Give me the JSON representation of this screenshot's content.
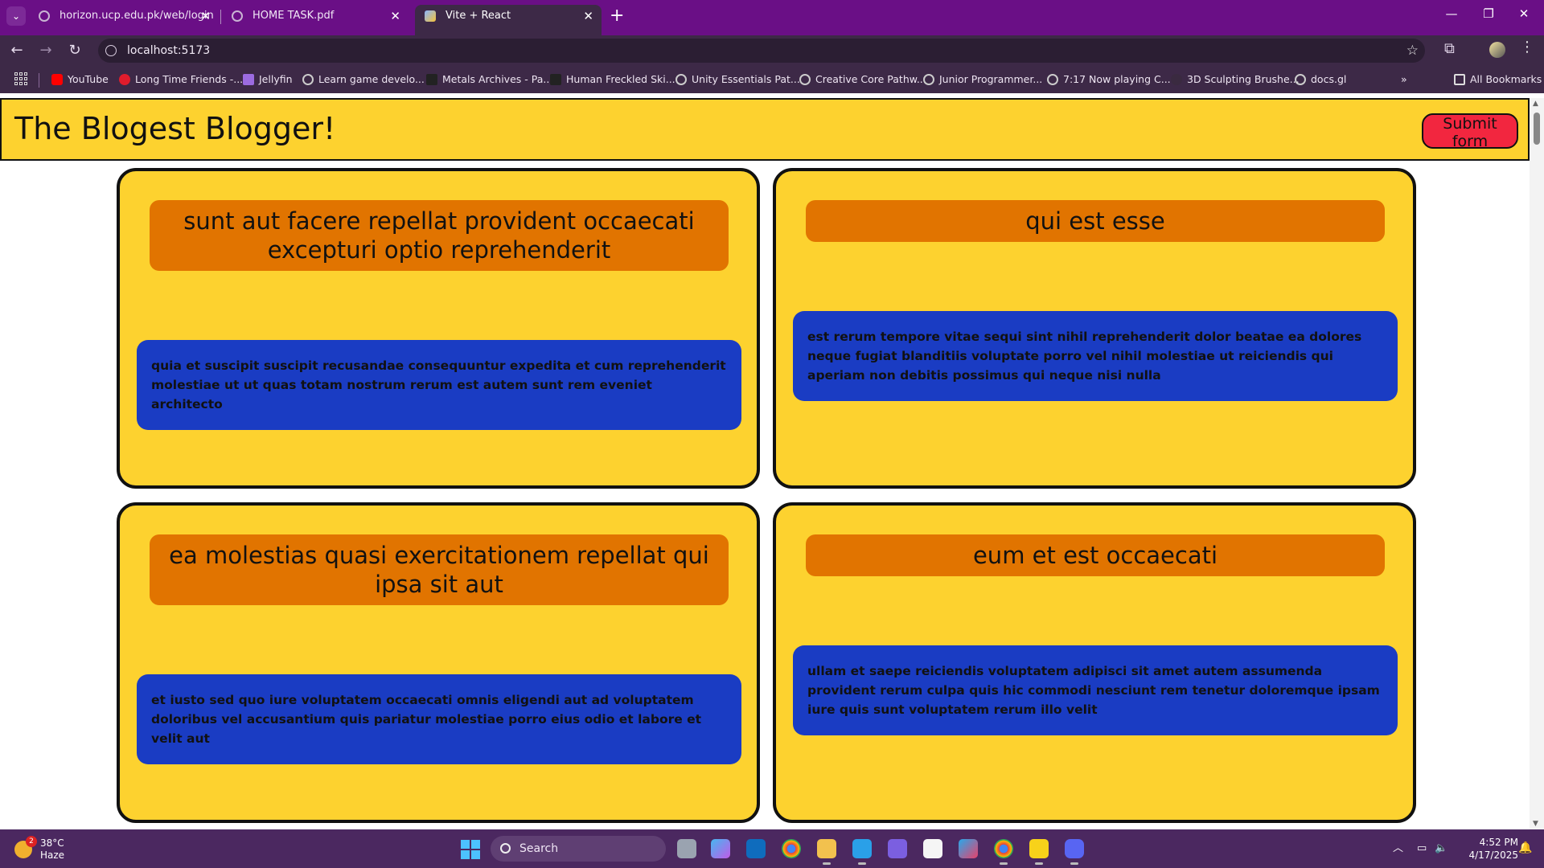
{
  "browser": {
    "tabs": [
      {
        "title": "horizon.ucp.edu.pk/web/login",
        "active": false
      },
      {
        "title": "HOME TASK.pdf",
        "active": false
      },
      {
        "title": "Vite + React",
        "active": true
      }
    ],
    "url": "localhost:5173",
    "bookmarks": [
      "YouTube",
      "Long Time Friends -...",
      "Jellyfin",
      "Learn game develo...",
      "Metals Archives - Pa...",
      "Human Freckled Ski...",
      "Unity Essentials Pat...",
      "Creative Core Pathw...",
      "Junior Programmer...",
      "7:17 Now playing C...",
      "3D Sculpting Brushe...",
      "docs.gl"
    ],
    "all_bookmarks": "All Bookmarks",
    "overflow": "»"
  },
  "app": {
    "title": "The Blogest Blogger!",
    "submit_label": "Submit form",
    "colors": {
      "header": "#fdd22f",
      "title_box": "#e17400",
      "body_box": "#1a3cc3",
      "submit": "#f2263f"
    },
    "posts": [
      {
        "title": "sunt aut facere repellat provident occaecati excepturi optio reprehenderit",
        "body": "quia et suscipit suscipit recusandae consequuntur expedita et cum reprehenderit molestiae ut ut quas totam nostrum rerum est autem sunt rem eveniet architecto"
      },
      {
        "title": "qui est esse",
        "body": "est rerum tempore vitae sequi sint nihil reprehenderit dolor beatae ea dolores neque fugiat blanditiis voluptate porro vel nihil molestiae ut reiciendis qui aperiam non debitis possimus qui neque nisi nulla"
      },
      {
        "title": "ea molestias quasi exercitationem repellat qui ipsa sit aut",
        "body": "et iusto sed quo iure voluptatem occaecati omnis eligendi aut ad voluptatem doloribus vel accusantium quis pariatur molestiae porro eius odio et labore et velit aut"
      },
      {
        "title": "eum et est occaecati",
        "body": "ullam et saepe reiciendis voluptatem adipisci sit amet autem assumenda provident rerum culpa quis hic commodi nesciunt rem tenetur doloremque ipsam iure quis sunt voluptatem rerum illo velit"
      }
    ]
  },
  "taskbar": {
    "weather_temp": "38°C",
    "weather_desc": "Haze",
    "weather_badge": "2",
    "search_label": "Search",
    "time": "4:52 PM",
    "date": "4/17/2025"
  }
}
